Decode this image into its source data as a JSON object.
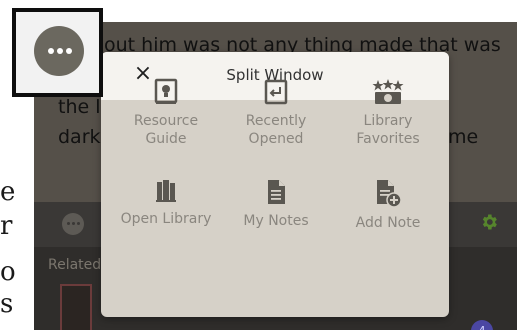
{
  "outer": {
    "char_1": "e",
    "char_2": "r",
    "char_3": "o",
    "char_4": "s"
  },
  "book": {
    "line1": "out him was not any thing made that was",
    "line2": "the l",
    "line3_left": "dark",
    "line3_right": "me"
  },
  "bottom": {
    "related_label": "Related",
    "badge_count": "4"
  },
  "modal": {
    "title": "Split Window",
    "close_label": "×",
    "items": [
      {
        "label": "Resource\nGuide",
        "icon": "resource-guide-icon"
      },
      {
        "label": "Recently\nOpened",
        "icon": "recently-opened-icon"
      },
      {
        "label": "Library\nFavorites",
        "icon": "library-favorites-icon"
      },
      {
        "label": "Open Library",
        "icon": "open-library-icon"
      },
      {
        "label": "My Notes",
        "icon": "my-notes-icon"
      },
      {
        "label": "Add Note",
        "icon": "add-note-icon"
      }
    ]
  },
  "colors": {
    "modal_bg": "#d6d1c8",
    "modal_header": "#f5f3ef",
    "accent_green": "#56852c",
    "badge": "#4b47a3"
  }
}
